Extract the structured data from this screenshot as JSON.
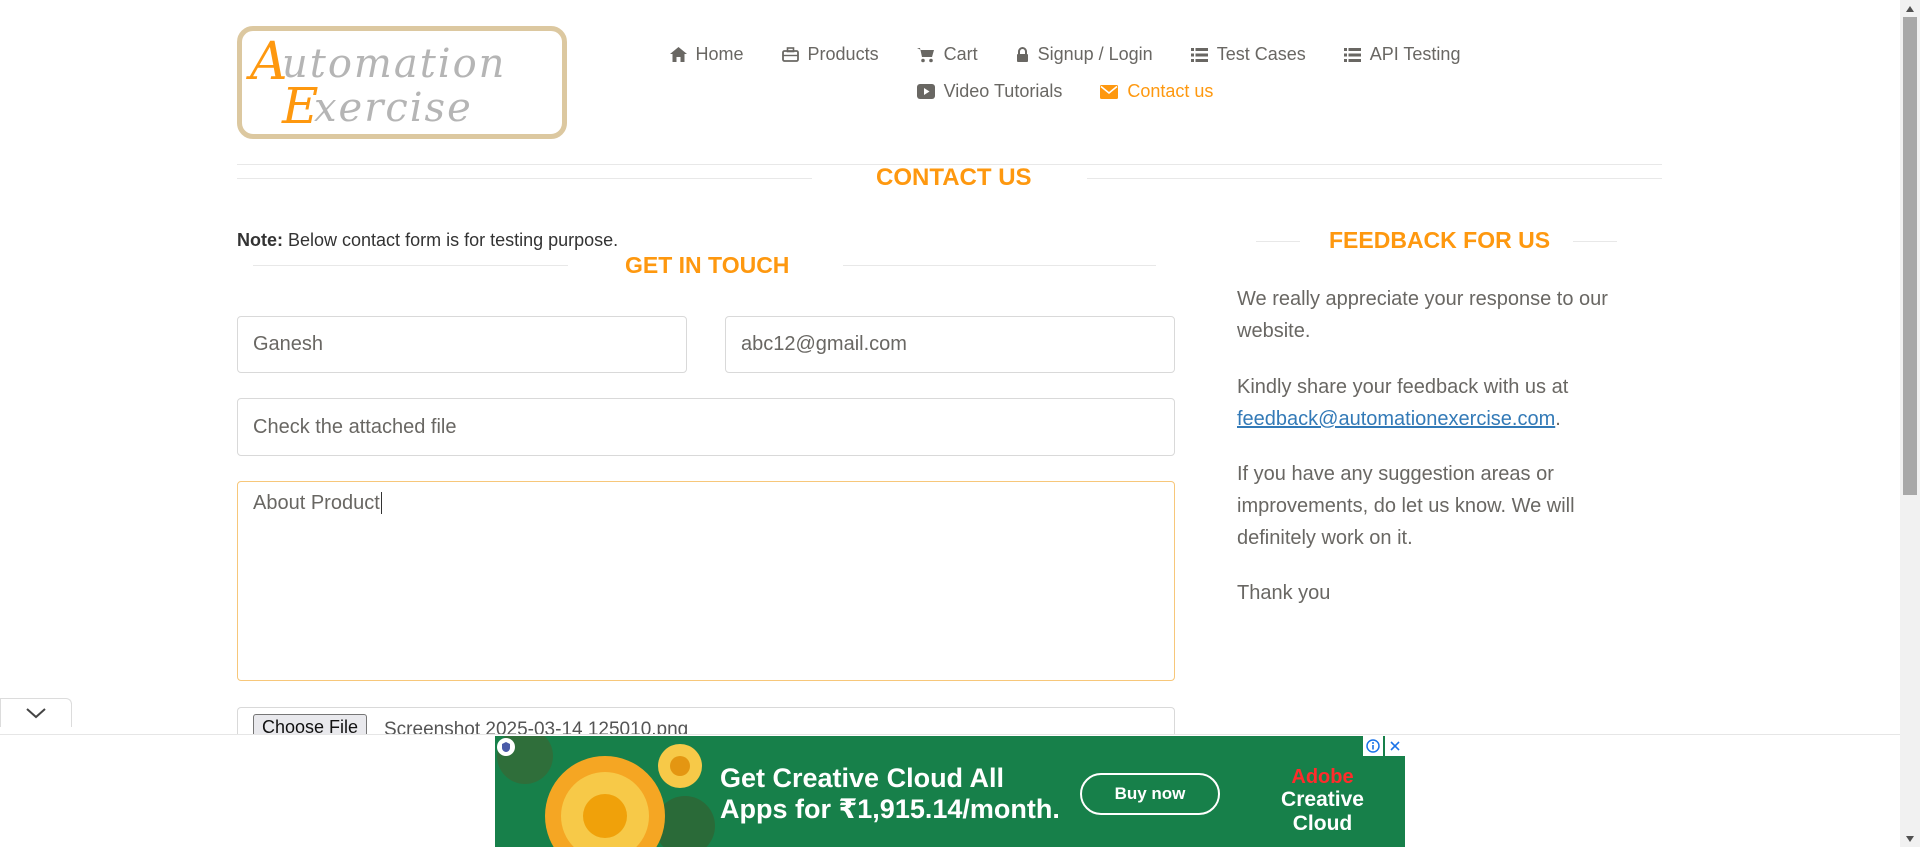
{
  "logo": {
    "line1": "Automation",
    "line2": "Exercise"
  },
  "nav": {
    "row1": [
      {
        "label": "Home",
        "icon": "home-icon"
      },
      {
        "label": "Products",
        "icon": "briefcase-icon"
      },
      {
        "label": "Cart",
        "icon": "cart-icon"
      },
      {
        "label": "Signup / Login",
        "icon": "lock-icon"
      },
      {
        "label": "Test Cases",
        "icon": "list-icon"
      },
      {
        "label": "API Testing",
        "icon": "list-icon"
      }
    ],
    "row2": [
      {
        "label": "Video Tutorials",
        "icon": "youtube-icon"
      },
      {
        "label": "Contact us",
        "icon": "envelope-icon",
        "active": true
      }
    ]
  },
  "page": {
    "title": "CONTACT US",
    "note_bold": "Note:",
    "note_text": " Below contact form is for testing purpose."
  },
  "form": {
    "title": "GET IN TOUCH",
    "name_value": "Ganesh",
    "email_value": "abc12@gmail.com",
    "subject_value": "Check the attached file",
    "message_value": "About Product",
    "choose_file_label": "Choose File",
    "file_name": "Screenshot 2025-03-14 125010.png"
  },
  "feedback": {
    "title": "FEEDBACK FOR US",
    "p1": "We really appreciate your response to our website.",
    "p2_text": "Kindly share your feedback with us at",
    "p2_link": "feedback@automationexercise.com",
    "p2_tail": ".",
    "p3": "If you have any suggestion areas or improvements, do let us know. We will definitely work on it.",
    "p4": "Thank you"
  },
  "ad": {
    "headline1": "Get Creative Cloud All",
    "headline2": "Apps for ₹1,915.14/month.",
    "cta": "Buy now",
    "brand1": "Adobe",
    "brand2": "Creative Cloud"
  },
  "colors": {
    "accent": "#fe980f",
    "text": "#696763",
    "link": "#337ab7",
    "ad_bg": "#17804a"
  }
}
